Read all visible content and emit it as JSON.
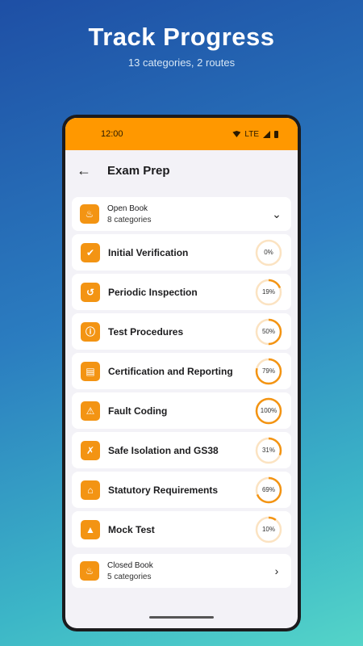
{
  "promo": {
    "title": "Track Progress",
    "subtitle": "13 categories, 2 routes"
  },
  "status_bar": {
    "time": "12:00",
    "network": "LTE"
  },
  "app_bar": {
    "title": "Exam Prep"
  },
  "groups": {
    "open": {
      "title": "Open Book",
      "subtitle": "8 categories"
    },
    "closed": {
      "title": "Closed Book",
      "subtitle": "5 categories"
    }
  },
  "categories": [
    {
      "label": "Initial Verification",
      "progress": 0,
      "progress_label": "0%",
      "icon": "badge-check-icon"
    },
    {
      "label": "Periodic Inspection",
      "progress": 19,
      "progress_label": "19%",
      "icon": "history-icon"
    },
    {
      "label": "Test Procedures",
      "progress": 50,
      "progress_label": "50%",
      "icon": "info-icon"
    },
    {
      "label": "Certification and Reporting",
      "progress": 79,
      "progress_label": "79%",
      "icon": "document-icon"
    },
    {
      "label": "Fault Coding",
      "progress": 100,
      "progress_label": "100%",
      "icon": "warning-icon"
    },
    {
      "label": "Safe Isolation and GS38",
      "progress": 31,
      "progress_label": "31%",
      "icon": "isolation-icon"
    },
    {
      "label": "Statutory Requirements",
      "progress": 69,
      "progress_label": "69%",
      "icon": "bank-icon"
    },
    {
      "label": "Mock Test",
      "progress": 10,
      "progress_label": "10%",
      "icon": "graduation-cap-icon"
    }
  ],
  "colors": {
    "accent": "#ff9800",
    "icon_bg": "#f39413",
    "ring_track": "#fbe3c2",
    "ring_fill": "#f39413"
  }
}
